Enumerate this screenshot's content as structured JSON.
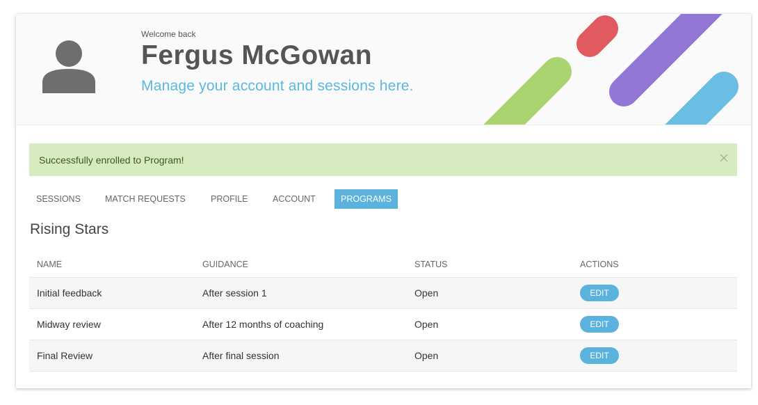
{
  "header": {
    "welcome": "Welcome back",
    "user_name": "Fergus McGowan",
    "tagline": "Manage your account and sessions here.",
    "avatar_icon": "user-silhouette-icon"
  },
  "alert": {
    "message": "Successfully enrolled to Program!",
    "close_icon": "close-icon"
  },
  "tabs": [
    {
      "label": "SESSIONS",
      "active": false
    },
    {
      "label": "MATCH REQUESTS",
      "active": false
    },
    {
      "label": "PROFILE",
      "active": false
    },
    {
      "label": "ACCOUNT",
      "active": false
    },
    {
      "label": "PROGRAMS",
      "active": true
    }
  ],
  "program": {
    "title": "Rising Stars",
    "columns": [
      "NAME",
      "GUIDANCE",
      "STATUS",
      "ACTIONS"
    ],
    "rows": [
      {
        "name": "Initial feedback",
        "guidance": "After session 1",
        "status": "Open",
        "action": "EDIT"
      },
      {
        "name": "Midway review",
        "guidance": "After 12 months of coaching",
        "status": "Open",
        "action": "EDIT"
      },
      {
        "name": "Final Review",
        "guidance": "After final session",
        "status": "Open",
        "action": "EDIT"
      }
    ]
  },
  "colors": {
    "accent": "#5bb2dc",
    "alert_bg": "#d7ebc0",
    "stripe_red": "#e05a60",
    "stripe_purple": "#9277d6",
    "stripe_green": "#a8d36e",
    "stripe_blue": "#6cbde3"
  }
}
